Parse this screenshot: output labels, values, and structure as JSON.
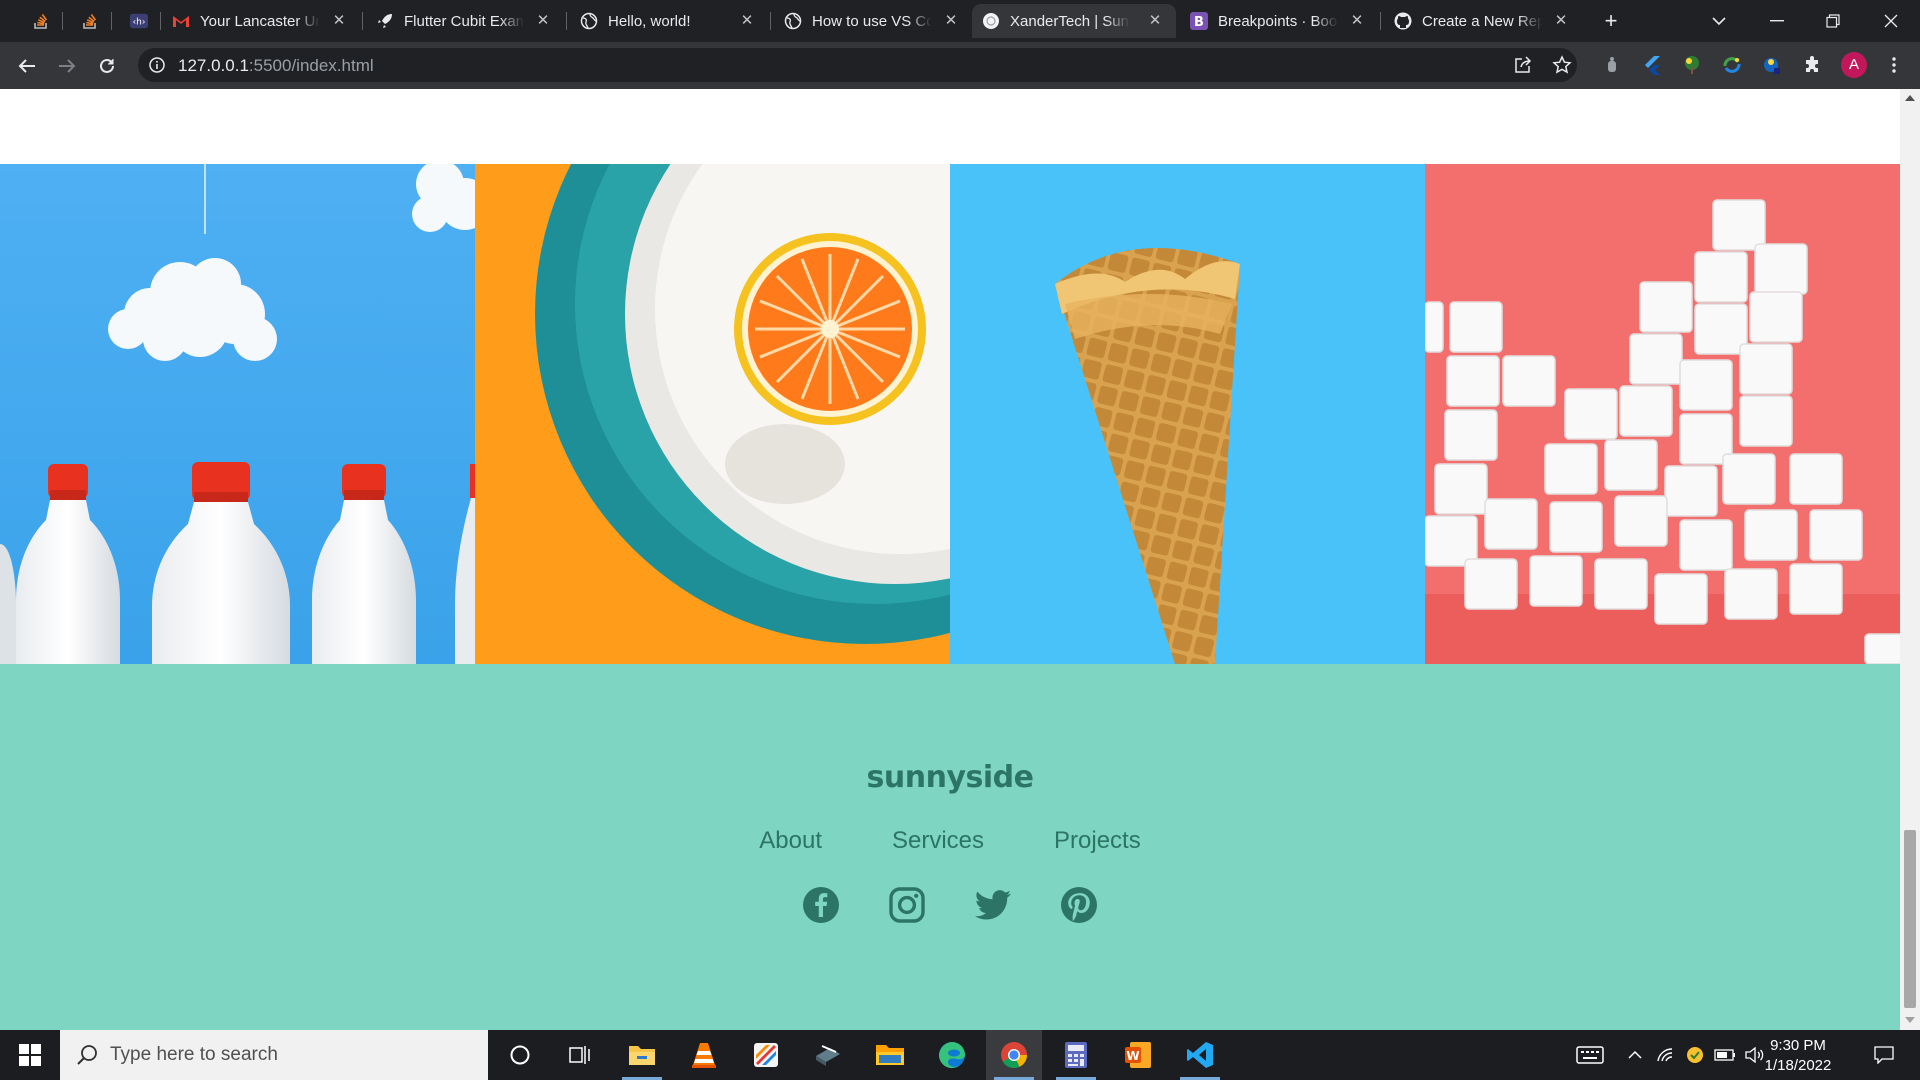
{
  "browser": {
    "tabs": [
      {
        "title": "",
        "favicon": "stackoverflow-icon"
      },
      {
        "title": "",
        "favicon": "stackoverflow-icon"
      },
      {
        "title": "",
        "favicon": "html-icon"
      },
      {
        "title": "Your Lancaster Uni",
        "favicon": "gmail-icon"
      },
      {
        "title": "Flutter Cubit Exam",
        "favicon": "rocket-icon"
      },
      {
        "title": "Hello, world!",
        "favicon": "globe-icon"
      },
      {
        "title": "How to use VS Co",
        "favicon": "globe-icon"
      },
      {
        "title": "XanderTech | Sunn",
        "favicon": "globe-icon",
        "active": true
      },
      {
        "title": "Breakpoints · Boot",
        "favicon": "bootstrap-icon"
      },
      {
        "title": "Create a New Repo",
        "favicon": "github-icon"
      }
    ],
    "new_tab": "+",
    "address": {
      "host": "127.0.0.1",
      "path": ":5500/index.html"
    },
    "profile_initial": "A"
  },
  "page": {
    "logo": "sunnyside",
    "footer_links": [
      "About",
      "Services",
      "Projects"
    ],
    "social": [
      "facebook-icon",
      "instagram-icon",
      "twitter-icon",
      "pinterest-icon"
    ],
    "colors": {
      "footer_bg": "#7ed5c1",
      "footer_text": "#2c7566"
    }
  },
  "taskbar": {
    "search_placeholder": "Type here to search",
    "time": "9:30 PM",
    "date": "1/18/2022"
  }
}
